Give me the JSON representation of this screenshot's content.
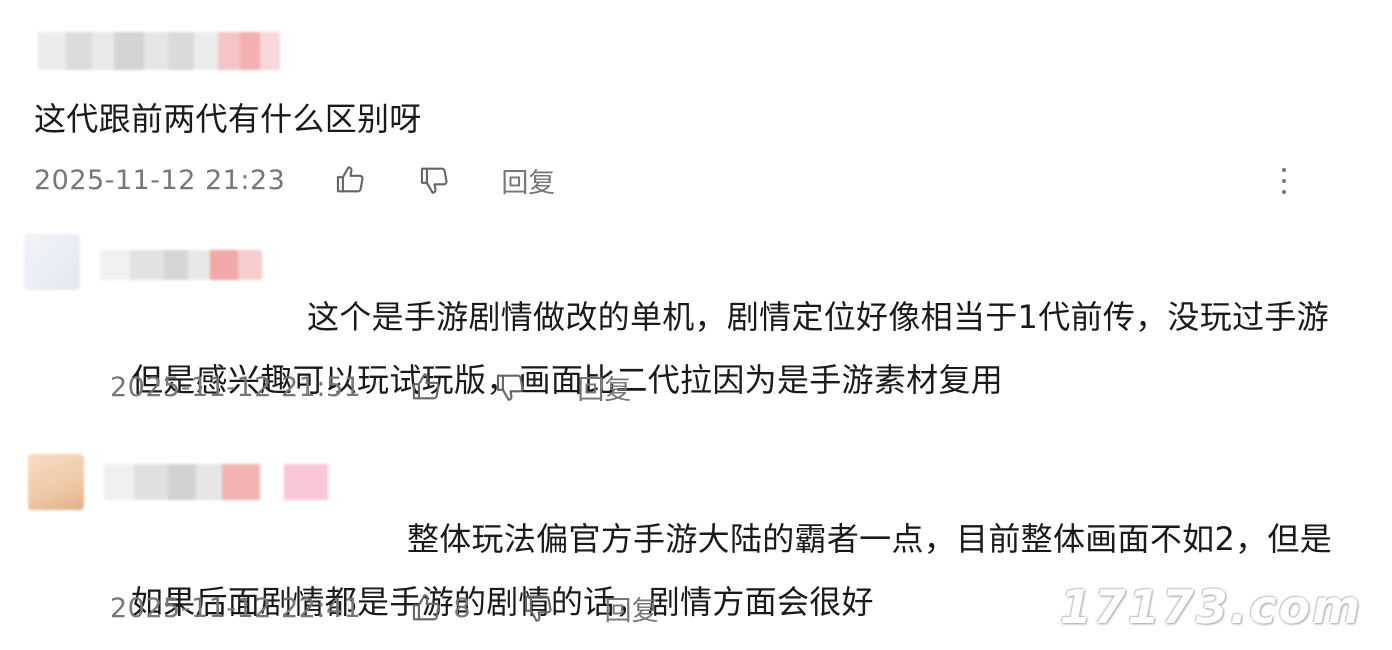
{
  "comments": [
    {
      "text": "这代跟前两代有什么区别呀",
      "time": "2025-11-12 21:23",
      "reply_label": "回复"
    },
    {
      "text": "这个是手游剧情做改的单机，剧情定位好像相当于1代前传，没玩过手游",
      "text_line2": "但是感兴趣可以玩试玩版，画面比二代拉因为是手游素材复用",
      "time": "2025-11-12 21:51",
      "reply_label": "回复"
    },
    {
      "text": "整体玩法偏官方手游大陆的霸者一点，目前整体画面不如2，但是",
      "text_line2": "如果后面剧情都是手游的剧情的话，剧情方面会很好",
      "time": "2025-11-12 22:41",
      "like_count": "8",
      "reply_label": "回复"
    }
  ],
  "icons": {
    "like": "thumbs-up-icon",
    "dislike": "thumbs-down-icon",
    "more": "more-vertical-icon"
  },
  "watermark": "17173.com",
  "colors": {
    "text": "#1a1a1a",
    "meta": "#777777",
    "background": "#ffffff"
  }
}
